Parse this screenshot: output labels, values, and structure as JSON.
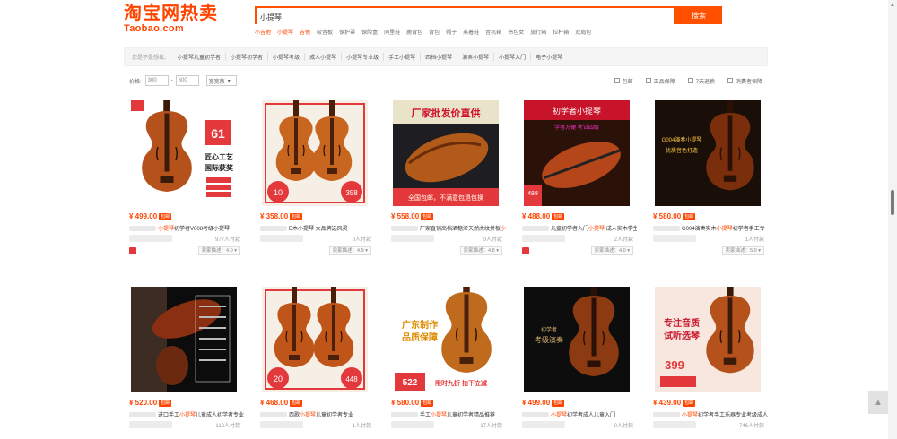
{
  "header": {
    "logo_cn": "淘宝网热卖",
    "logo_en": "Taobao.com",
    "search_value": "小提琴",
    "search_button": "搜索",
    "hotwords": [
      {
        "label": "小吉他",
        "hot": true
      },
      {
        "label": "小提琴",
        "hot": true
      },
      {
        "label": "吉他",
        "hot": true
      },
      {
        "label": "吸音板",
        "hot": false
      },
      {
        "label": "保护罩",
        "hot": false
      },
      {
        "label": "保险盒",
        "hot": false
      },
      {
        "label": "同里鞋",
        "hot": false
      },
      {
        "label": "鹿背包",
        "hot": false
      },
      {
        "label": "背包",
        "hot": false
      },
      {
        "label": "帽子",
        "hot": false
      },
      {
        "label": "蒸着鞋",
        "hot": false
      },
      {
        "label": "音机箱",
        "hot": false
      },
      {
        "label": "书包女",
        "hot": false
      },
      {
        "label": "旅行箱",
        "hot": false
      },
      {
        "label": "拉杆箱",
        "hot": false
      },
      {
        "label": "双肩包",
        "hot": false
      }
    ]
  },
  "filter": {
    "label": "您是不是想找：",
    "options": [
      "小提琴儿童初学者",
      "小提琴初学者",
      "小提琴考级",
      "成人小提琴",
      "小提琴专业级",
      "手工小提琴",
      "西档小提琴",
      "演奏小提琴",
      "小提琴入门",
      "电子小提琴"
    ]
  },
  "price_filter": {
    "label": "价格:",
    "min": "300",
    "max": "600",
    "sort": "宽宽敞",
    "checks": [
      "包邮",
      "正品保障",
      "7天退换",
      "消费者保障"
    ]
  },
  "products": [
    {
      "price": "¥ 499.00",
      "tag": "包邮",
      "title_pre": "",
      "title_hl": "小提琴",
      "title_post": "初学者V008考级小提琴",
      "sales": "977人付款",
      "rating": "卖家描述：4.0",
      "mark": true
    },
    {
      "price": "¥ 358.00",
      "tag": "包邮",
      "title_pre": "",
      "title_hl": "",
      "title_post": "E木小提琴 大品牌选风灵",
      "sales": "0人付款",
      "rating": "卖家描述：4.9",
      "mark": false
    },
    {
      "price": "¥ 558.00",
      "tag": "包邮",
      "title_pre": "厂家直销高档酒糖漆天然虎纹拼板",
      "title_hl": "小提琴",
      "title_post": "",
      "sales": "0人付款",
      "rating": "卖家描述：4.8",
      "mark": false
    },
    {
      "price": "¥ 488.00",
      "tag": "包邮",
      "title_pre": "儿童初学者入门",
      "title_hl": "小提琴",
      "title_post": " 成人实木学生纯手",
      "sales": "2人付款",
      "rating": "卖家描述：4.0",
      "mark": true
    },
    {
      "price": "¥ 580.00",
      "tag": "包邮",
      "title_pre": "G004演奏实木",
      "title_hl": "小提琴",
      "title_post": "初学者手工专",
      "sales": "1人付款",
      "rating": "卖家描述：5.0",
      "mark": false
    },
    {
      "price": "¥ 520.00",
      "tag": "包邮",
      "title_pre": "进口手工",
      "title_hl": "小提琴",
      "title_post": "儿童成人初学者专业级小",
      "sales": "112人付款",
      "rating": "",
      "mark": false
    },
    {
      "price": "¥ 468.00",
      "tag": "包邮",
      "title_pre": "西歌",
      "title_hl": "小提琴",
      "title_post": "儿童初学者专业",
      "sales": "1人付款",
      "rating": "",
      "mark": false
    },
    {
      "price": "¥ 580.00",
      "tag": "包邮",
      "title_pre": "手工",
      "title_hl": "小提琴",
      "title_post": "儿童初学者精品推荐",
      "sales": "17人付款",
      "rating": "",
      "mark": false
    },
    {
      "price": "¥ 499.00",
      "tag": "包邮",
      "title_pre": "",
      "title_hl": "小提琴",
      "title_post": "初学者成人儿童入门",
      "sales": "0人付款",
      "rating": "",
      "mark": false
    },
    {
      "price": "¥ 439.00",
      "tag": "包邮",
      "title_pre": "",
      "title_hl": "小提琴",
      "title_post": "初学者手工乐器专业考级成人",
      "sales": "746人付款",
      "rating": "",
      "mark": false
    }
  ],
  "badges": {
    "p1_num": "61",
    "p1_lines": [
      "匠心工艺",
      "国际获奖"
    ],
    "p3_banner": "厂家批发价直供",
    "p3_footer": "全国包邮，不满意包退包换",
    "p4_banner": "初学者小提琴",
    "p4_sub": "学者方便 考试四级",
    "p4_price": "488",
    "p5_lines": [
      "G004演奏小提琴",
      "优质音色打造"
    ],
    "p7_price": "448",
    "p7b_price": "20",
    "p2_price": "358",
    "p2b_price": "10",
    "p8_lines": [
      "广东制作",
      "品质保障"
    ],
    "p8_price": "522",
    "p8_promo": "限时九折 拍下立减",
    "p9_lines": [
      "初学者",
      "考级演奏"
    ],
    "p10_lines": [
      "专注音质",
      "试听选琴"
    ],
    "p10_price": "399"
  },
  "colors": {
    "brand": "#ff4400",
    "search_border": "#ff5000"
  }
}
